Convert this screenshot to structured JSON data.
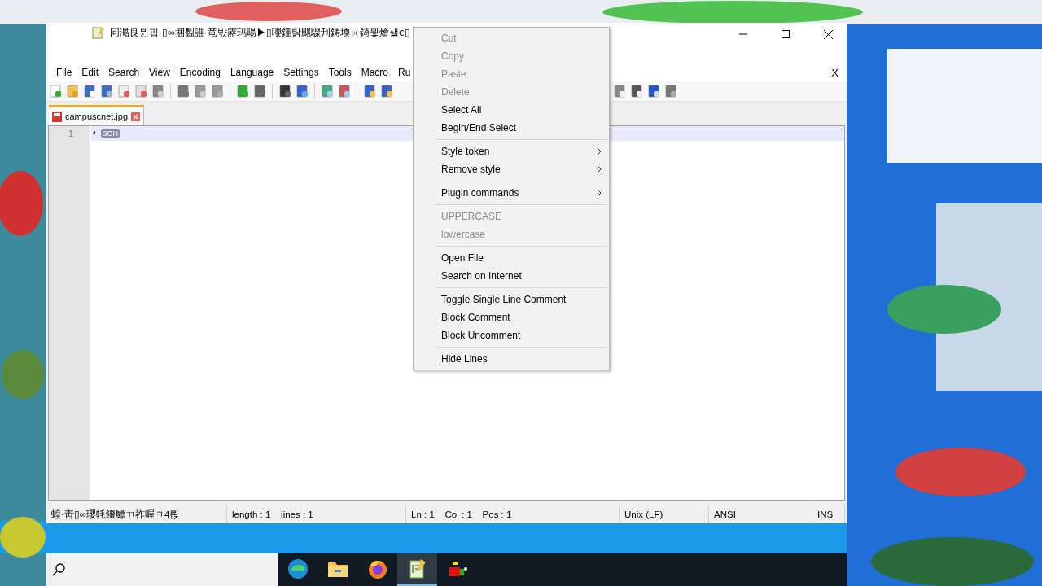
{
  "window": {
    "title": "冋澔良뮌핍·▯∞捆蠫誰·竜뱏靂玛暘▶▯嚶鍾탉颼驟刋鋳堧ㄨ錡뭧燴샐ⅽ▯"
  },
  "menubar": {
    "items": [
      "File",
      "Edit",
      "Search",
      "View",
      "Encoding",
      "Language",
      "Settings",
      "Tools",
      "Macro",
      "Ru"
    ],
    "close_label": "X"
  },
  "tabs": [
    {
      "label": "campuscnet.jpg",
      "selected": true
    }
  ],
  "editor": {
    "lines": [
      {
        "number": "1",
        "text": "ᵌ",
        "control_char": "SOH",
        "current": true
      }
    ]
  },
  "status_bar": [
    "蝗·靑▯∞瓔軞餟鰾ㄲ祚喔ᆿ4뢵",
    "length : 1    lines : 1",
    "Ln : 1    Col : 1    Pos : 1",
    "Unix (LF)",
    "ANSI",
    "INS"
  ],
  "context_menu": {
    "items": [
      {
        "kind": "item",
        "label": "Cut",
        "disabled": true,
        "submenu": false
      },
      {
        "kind": "item",
        "label": "Copy",
        "disabled": true,
        "submenu": false
      },
      {
        "kind": "item",
        "label": "Paste",
        "disabled": true,
        "submenu": false
      },
      {
        "kind": "item",
        "label": "Delete",
        "disabled": true,
        "submenu": false
      },
      {
        "kind": "item",
        "label": "Select All",
        "disabled": false,
        "submenu": false
      },
      {
        "kind": "item",
        "label": "Begin/End Select",
        "disabled": false,
        "submenu": false
      },
      {
        "kind": "separator"
      },
      {
        "kind": "item",
        "label": "Style token",
        "disabled": false,
        "submenu": true
      },
      {
        "kind": "item",
        "label": "Remove style",
        "disabled": false,
        "submenu": true
      },
      {
        "kind": "separator"
      },
      {
        "kind": "item",
        "label": "Plugin commands",
        "disabled": false,
        "submenu": true
      },
      {
        "kind": "separator"
      },
      {
        "kind": "item",
        "label": "UPPERCASE",
        "disabled": true,
        "submenu": false
      },
      {
        "kind": "item",
        "label": "lowercase",
        "disabled": true,
        "submenu": false
      },
      {
        "kind": "separator"
      },
      {
        "kind": "item",
        "label": "Open File",
        "disabled": false,
        "submenu": false
      },
      {
        "kind": "item",
        "label": "Search on Internet",
        "disabled": false,
        "submenu": false
      },
      {
        "kind": "separator"
      },
      {
        "kind": "item",
        "label": "Toggle Single Line Comment",
        "disabled": false,
        "submenu": false
      },
      {
        "kind": "item",
        "label": "Block Comment",
        "disabled": false,
        "submenu": false
      },
      {
        "kind": "item",
        "label": "Block Uncomment",
        "disabled": false,
        "submenu": false
      },
      {
        "kind": "separator"
      },
      {
        "kind": "item",
        "label": "Hide Lines",
        "disabled": false,
        "submenu": false
      }
    ]
  },
  "taskbar": {
    "apps": [
      {
        "kind": "edge",
        "selected": false
      },
      {
        "kind": "folder",
        "selected": false
      },
      {
        "kind": "firefox",
        "selected": false
      },
      {
        "kind": "notepad",
        "selected": true
      },
      {
        "kind": "cubes",
        "selected": false
      }
    ]
  }
}
